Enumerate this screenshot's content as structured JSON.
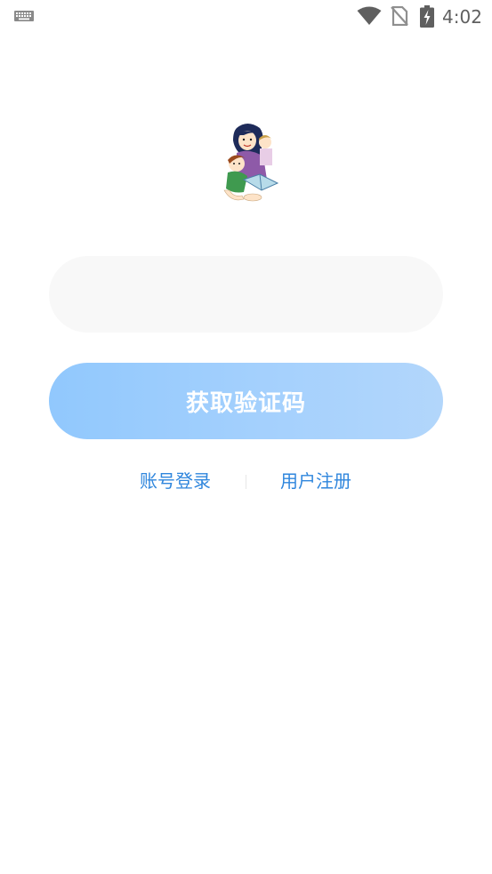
{
  "status_bar": {
    "time": "4:02",
    "icons": [
      "keyboard-icon",
      "wifi-icon",
      "no-sim-icon",
      "battery-charging-icon"
    ]
  },
  "logo": {
    "icon": "mother-reading-with-children-illustration"
  },
  "phone_field": {
    "value": "",
    "placeholder": ""
  },
  "get_code_button": {
    "label": "获取验证码"
  },
  "links": {
    "account_login": "账号登录",
    "register": "用户注册"
  },
  "colors": {
    "button_gradient_start": "#91c8fd",
    "button_gradient_end": "#b2d6fb",
    "link": "#2f86dd",
    "field_bg": "#f8f8f8"
  }
}
